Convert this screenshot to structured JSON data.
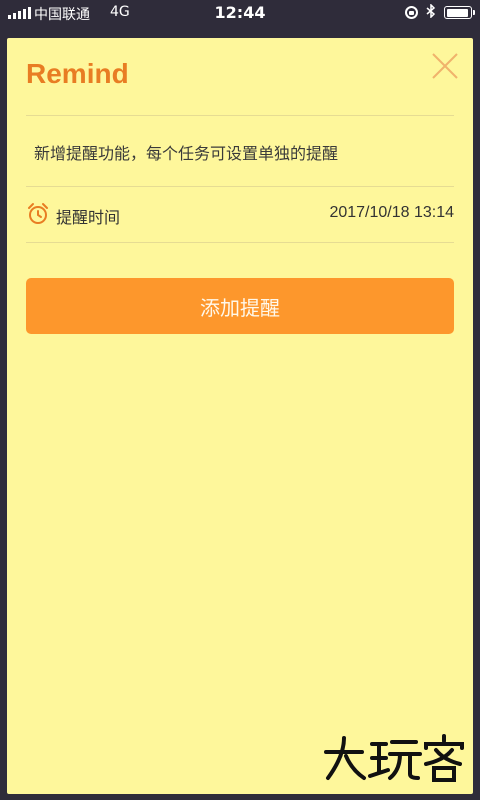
{
  "status_bar": {
    "carrier": "中国联通",
    "network": "4G",
    "time": "12:44",
    "battery_level": 0.95,
    "icons": [
      "signal-icon",
      "rotation-lock-icon",
      "bluetooth-icon",
      "battery-icon"
    ]
  },
  "card": {
    "title": "Remind",
    "close_icon": "close-icon",
    "description": "新增提醒功能，每个任务可设置单独的提醒",
    "reminder_time": {
      "icon": "alarm-clock-icon",
      "label": "提醒时间",
      "value": "2017/10/18 13:14"
    },
    "add_button_label": "添加提醒"
  },
  "watermark": {
    "text": "大玩客"
  },
  "colors": {
    "background": "#2f2c3a",
    "card": "#fef79b",
    "accent": "#e87d23",
    "button": "#fd972c",
    "divider": "#e6dc93",
    "text": "#333333"
  }
}
